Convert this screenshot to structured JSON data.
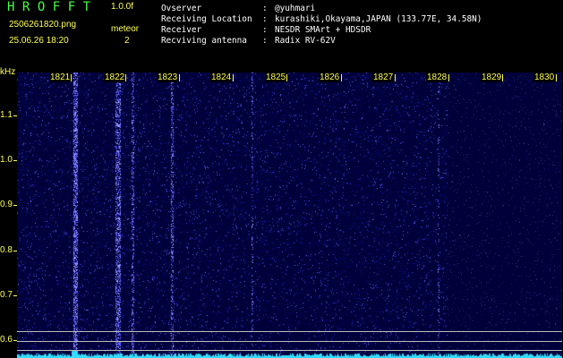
{
  "header": {
    "brand": "HROFFT",
    "version": "1.0.0f",
    "filename": "2506261820.png",
    "mode": "meteor",
    "datetime": "25.06.26 18:20",
    "count": "2"
  },
  "station_info": [
    {
      "label": "Ovserver",
      "value": "@yuhmari"
    },
    {
      "label": "Receiving Location",
      "value": "kurashiki,Okayama,JAPAN (133.77E, 34.58N)"
    },
    {
      "label": "Receiver",
      "value": "NESDR SMArt + HDSDR"
    },
    {
      "label": "Recviving antenna",
      "value": "Radix RV-62V"
    }
  ],
  "axes": {
    "y_unit": "kHz",
    "y_ticks": [
      "1.1",
      "1.0",
      "0.9",
      "0.8",
      "0.7",
      "0.6"
    ],
    "x_ticks": [
      "1821",
      "1822",
      "1823",
      "1824",
      "1825",
      "1826",
      "1827",
      "1828",
      "1829",
      "1830"
    ]
  },
  "colors": {
    "background": "#000000",
    "label_yellow": "#ffff55",
    "brand_green": "#44ff44",
    "info_white": "#ffffff",
    "spectrum_cyan": "#33ddff",
    "noise_blue": "#1a1aff"
  }
}
